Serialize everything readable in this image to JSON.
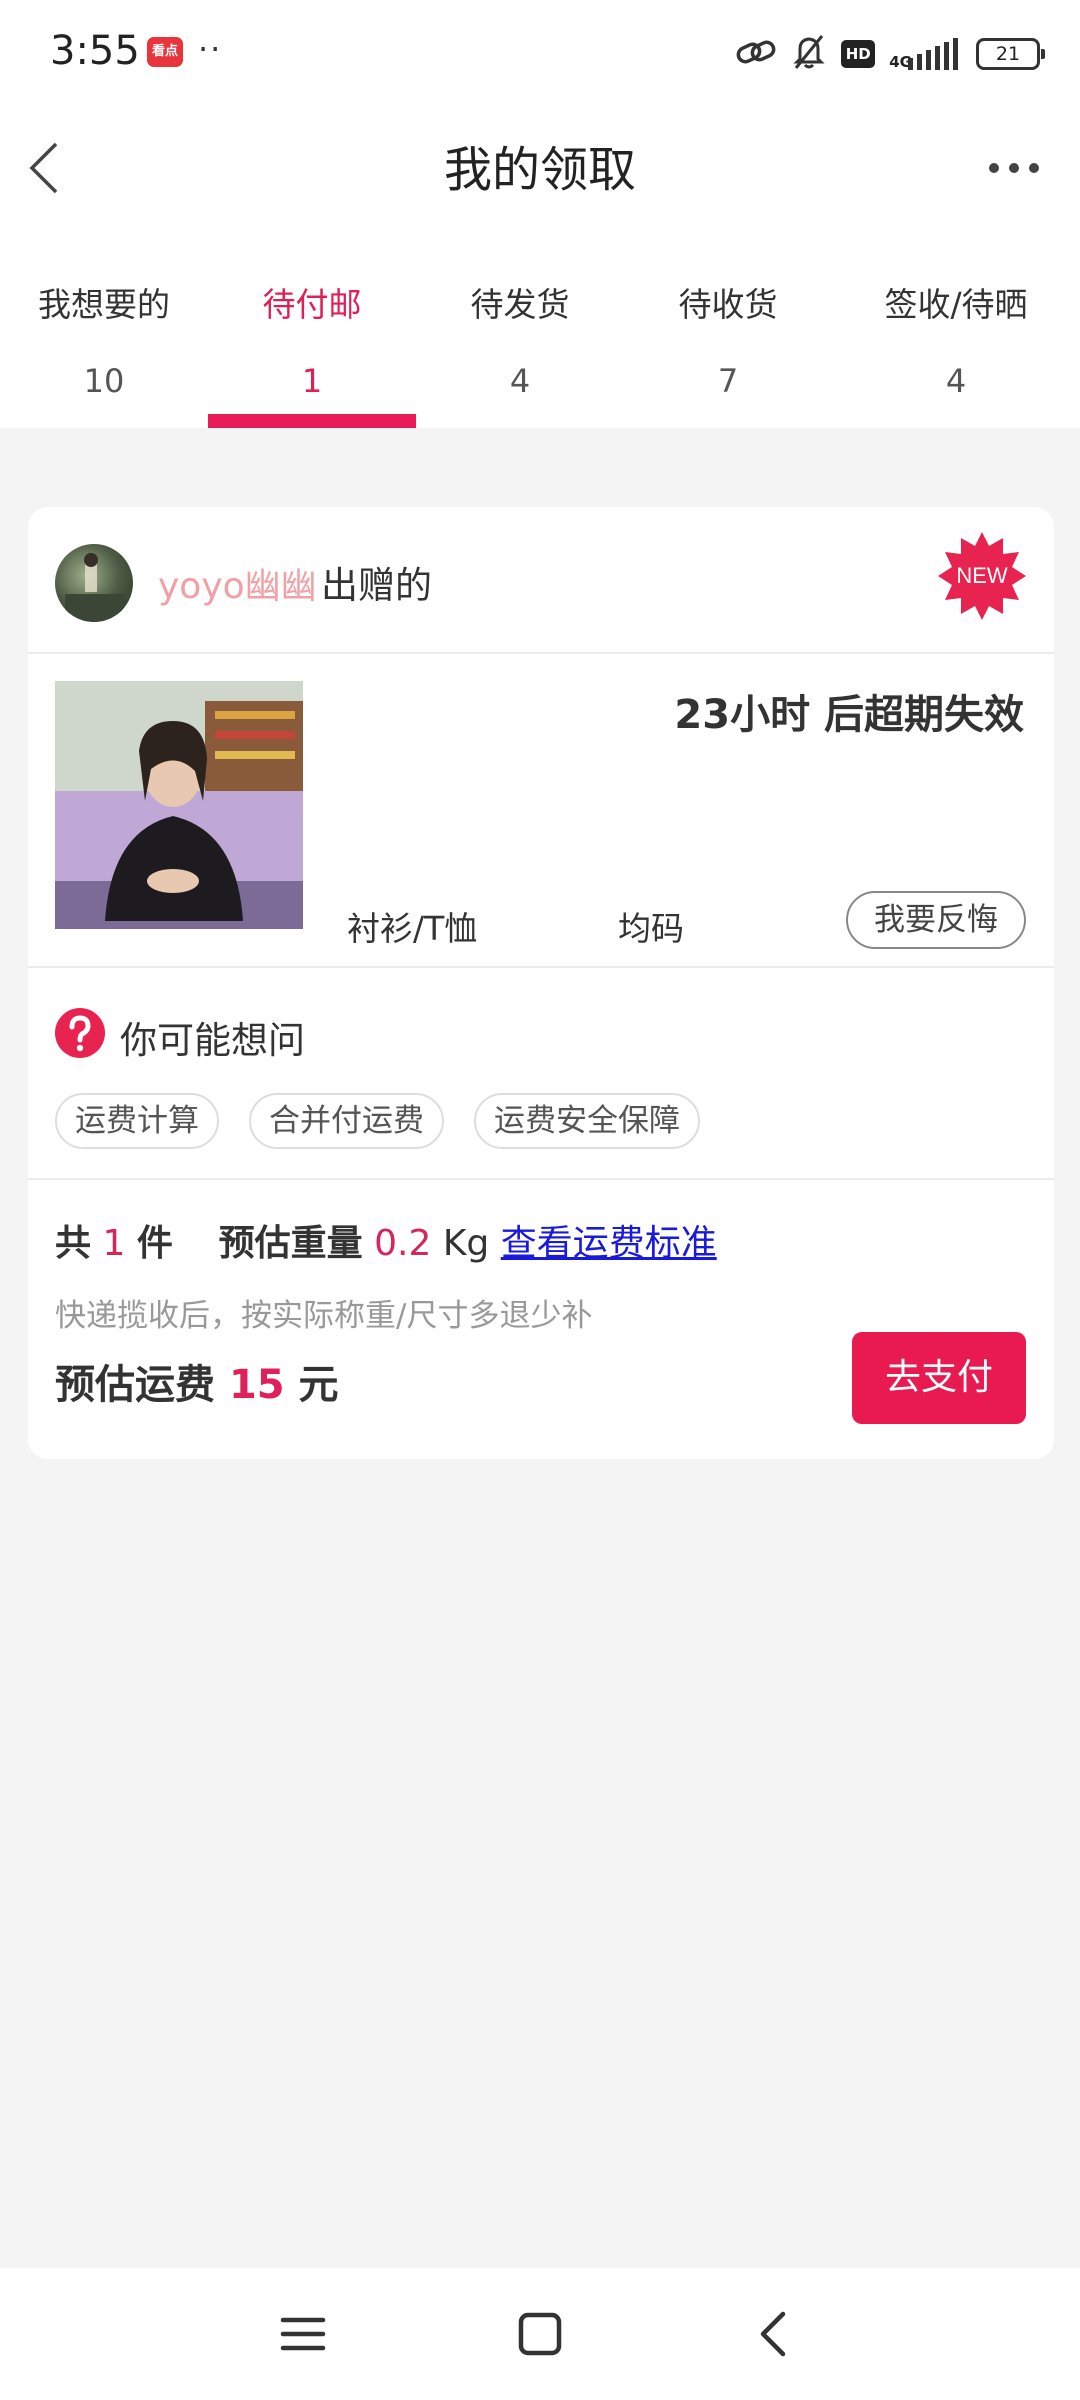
{
  "status_bar": {
    "time": "3:55",
    "app_icon_text": "看点",
    "dots": "··",
    "hd": "HD",
    "network": "4G",
    "battery": "21"
  },
  "header": {
    "title": "我的领取"
  },
  "tabs": [
    {
      "label": "我想要的",
      "count": "10"
    },
    {
      "label": "待付邮",
      "count": "1"
    },
    {
      "label": "待发货",
      "count": "4"
    },
    {
      "label": "待收货",
      "count": "7"
    },
    {
      "label": "签收/待晒",
      "count": "4"
    }
  ],
  "active_tab": 1,
  "card": {
    "seller_name": "yoyo幽幽",
    "seller_suffix": "出赠的",
    "new_badge": "NEW",
    "expire_text": "23小时 后超期失效",
    "category": "衬衫/T恤",
    "size": "均码",
    "regret_button": "我要反悔",
    "faq_title": "你可能想问",
    "faq_chips": [
      "运费计算",
      "合并付运费",
      "运费安全保障"
    ],
    "summary": {
      "total_prefix": "共",
      "total_count": "1",
      "total_suffix": "件",
      "weight_label": "预估重量",
      "weight_value": "0.2",
      "weight_unit": "Kg",
      "standard_link": "查看运费标准"
    },
    "note": "快递揽收后，按实际称重/尺寸多退少补",
    "fee": {
      "label": "预估运费",
      "value": "15",
      "unit": "元"
    },
    "pay_button": "去支付"
  },
  "colors": {
    "accent": "#e81d57",
    "link": "#1a1adc",
    "seller_name": "#f2a0a5",
    "background": "#f4f4f4"
  },
  "icons": {
    "back": "chevron-left-icon",
    "more": "more-horizontal-icon",
    "question": "question-circle-icon",
    "nav_menu": "menu-icon",
    "nav_home": "square-icon",
    "nav_back": "chevron-left-icon"
  }
}
